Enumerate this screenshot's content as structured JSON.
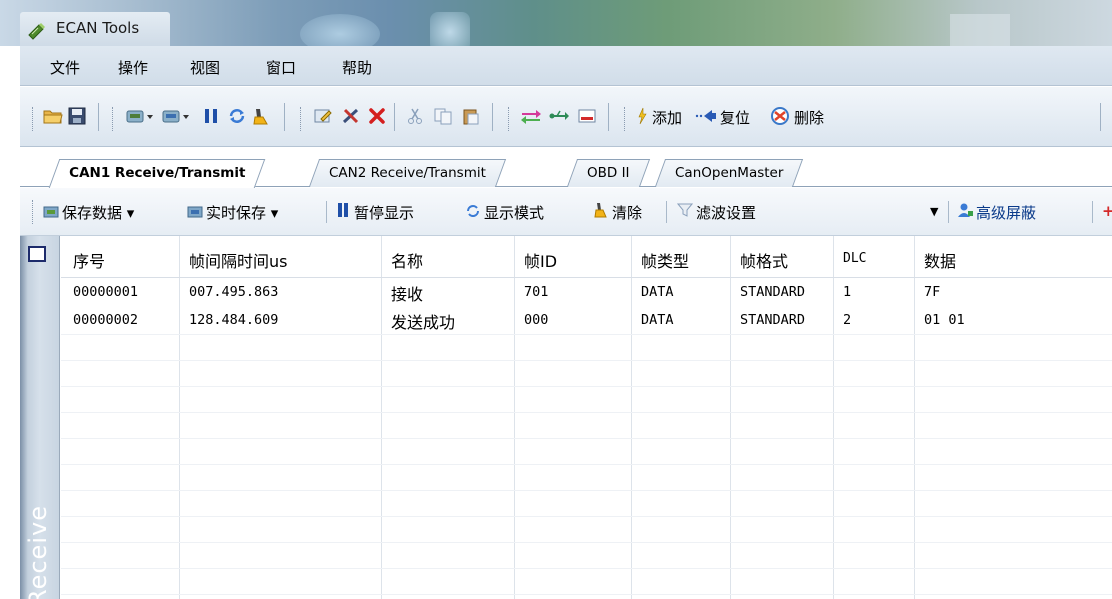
{
  "window": {
    "title": "ECAN Tools"
  },
  "menu": [
    "文件",
    "操作",
    "视图",
    "窗口",
    "帮助"
  ],
  "toolbar": {
    "add": "添加",
    "reset": "复位",
    "delete": "删除"
  },
  "tabs": [
    "CAN1 Receive/Transmit",
    "CAN2 Receive/Transmit",
    "OBD II",
    "CanOpenMaster"
  ],
  "actions": {
    "save_data": "保存数据",
    "realtime_save": "实时保存",
    "pause_display": "暂停显示",
    "display_mode": "显示模式",
    "clear": "清除",
    "filter_settings": "滤波设置",
    "advanced_mask": "高级屏蔽"
  },
  "sidebar": {
    "label": "Receive"
  },
  "table": {
    "columns": [
      "序号",
      "帧间隔时间us",
      "名称",
      "帧ID",
      "帧类型",
      "帧格式",
      "DLC",
      "数据"
    ],
    "rows": [
      [
        "00000001",
        "007.495.863",
        "接收",
        "701",
        "DATA",
        "STANDARD",
        "1",
        "7F"
      ],
      [
        "00000002",
        "128.484.609",
        "发送成功",
        "000",
        "DATA",
        "STANDARD",
        "2",
        "01 01"
      ]
    ]
  }
}
